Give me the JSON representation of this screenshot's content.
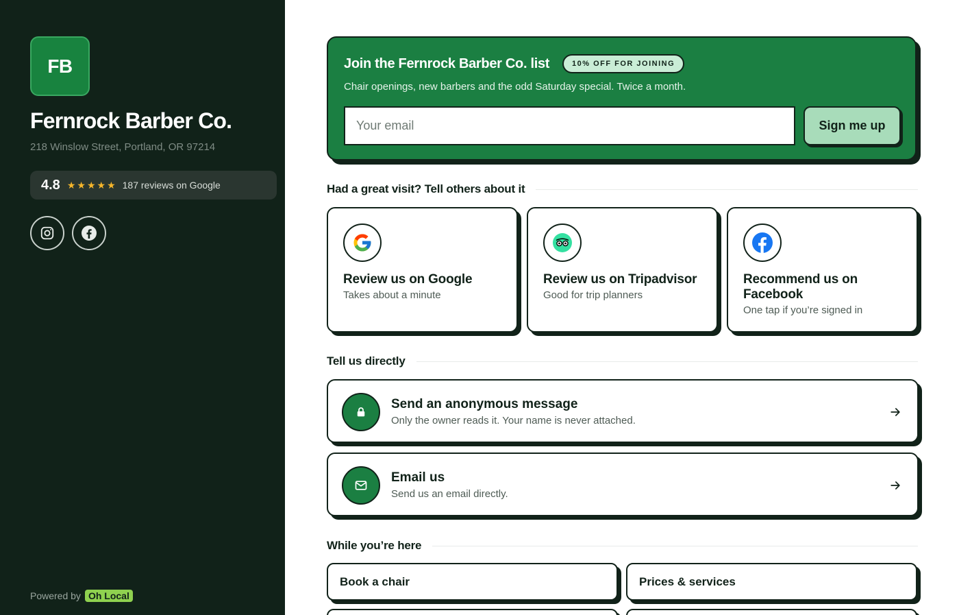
{
  "business": {
    "initials": "FB",
    "name": "Fernrock Barber Co.",
    "address": "218 Winslow Street, Portland, OR 97214",
    "rating": "4.8",
    "stars": 5,
    "reviews_text": "187 reviews on Google"
  },
  "social": [
    {
      "name": "instagram-icon"
    },
    {
      "name": "facebook-icon"
    }
  ],
  "footer": {
    "powered_by": "Powered by",
    "brand": "Oh Local"
  },
  "signup": {
    "title": "Join the Fernrock Barber Co. list",
    "badge": "10% OFF FOR JOINING",
    "subtitle": "Chair openings, new barbers and the odd Saturday special. Twice a month.",
    "email_placeholder": "Your email",
    "email_value": "",
    "button": "Sign me up"
  },
  "reviews_section": {
    "heading": "Had a great visit? Tell others about it",
    "cards": [
      {
        "title": "Review us on Google",
        "subtitle": "Takes about a minute",
        "icon": "google-icon"
      },
      {
        "title": "Review us on Tripadvisor",
        "subtitle": "Good for trip planners",
        "icon": "tripadvisor-icon"
      },
      {
        "title": "Recommend us on Facebook",
        "subtitle": "One tap if you’re signed in",
        "icon": "facebook-icon"
      }
    ]
  },
  "direct_section": {
    "heading": "Tell us directly",
    "items": [
      {
        "title": "Send an anonymous message",
        "subtitle": "Only the owner reads it. Your name is never attached.",
        "icon": "lock-icon"
      },
      {
        "title": "Email us",
        "subtitle": "Send us an email directly.",
        "icon": "mail-icon"
      }
    ]
  },
  "more_section": {
    "heading": "While you’re here",
    "links": [
      "Book a chair",
      "Prices & services"
    ]
  },
  "colors": {
    "sidebar_bg": "#112219",
    "brand_green": "#1b7f42",
    "accent_light": "#a8dcba",
    "star": "#f5b62b",
    "ink": "#112219"
  }
}
